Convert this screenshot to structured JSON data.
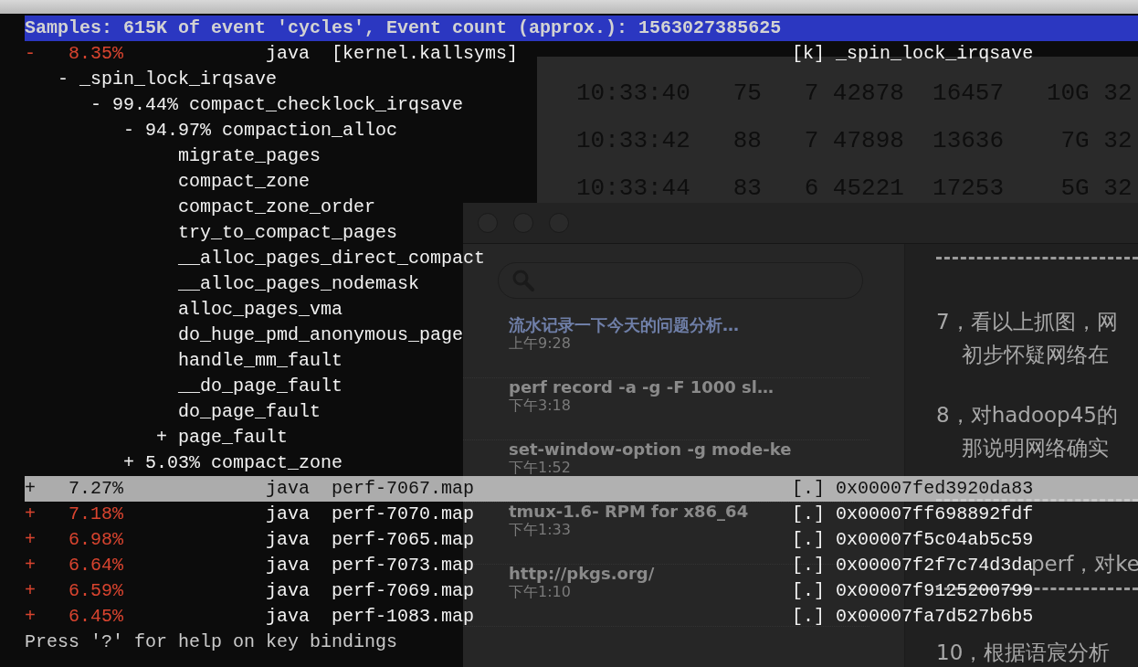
{
  "terminal": {
    "lines": [
      "10:33:40   75   7 42878  16457   10G 32",
      "10:33:42   88   7 47898  13636    7G 32",
      "10:33:44   83   6 45221  17253    5G 32"
    ]
  },
  "notes": {
    "items": [
      {
        "title": "流水记录一下今天的问题分析…",
        "time": "上午9:28",
        "selected": true
      },
      {
        "title": "perf record -a -g -F 1000 sl…",
        "time": "下午3:18",
        "selected": false
      },
      {
        "title": "set-window-option -g mode-ke",
        "time": "下午1:52",
        "selected": false
      },
      {
        "title": "tmux-1.6- RPM for x86_64",
        "time": "下午1:33",
        "selected": false
      },
      {
        "title": "http://pkgs.org/",
        "time": "下午1:10",
        "selected": false
      }
    ],
    "body": [
      {
        "kind": "rule"
      },
      {
        "kind": "text",
        "text": "7，看以上抓图，网"
      },
      {
        "kind": "indent",
        "text": "初步怀疑网络在"
      },
      {
        "kind": "text",
        "text": "8，对hadoop45的"
      },
      {
        "kind": "indent",
        "text": "那说明网络确实"
      },
      {
        "kind": "rule"
      },
      {
        "kind": "offset",
        "text": "perf，对ke"
      },
      {
        "kind": "rule"
      },
      {
        "kind": "text",
        "text": "10，根据语宸分析"
      }
    ]
  },
  "report": {
    "header": "Samples: 615K of event 'cycles', Event count (approx.): 1563027385625",
    "entries": [
      {
        "toggle": "-",
        "percent": "8.35%",
        "command": "java",
        "object": "[kernel.kallsyms]",
        "privilege": "[k]",
        "symbol": "_spin_lock_irqsave",
        "selected": false,
        "callchain": [
          {
            "marker": "-",
            "text": "_spin_lock_irqsave",
            "children": [
              {
                "marker": "-",
                "percent": "99.44%",
                "text": "compact_checklock_irqsave",
                "children": [
                  {
                    "marker": "-",
                    "percent": "94.97%",
                    "text": "compaction_alloc",
                    "children": [
                      {
                        "text": "migrate_pages"
                      },
                      {
                        "text": "compact_zone"
                      },
                      {
                        "text": "compact_zone_order"
                      },
                      {
                        "text": "try_to_compact_pages"
                      },
                      {
                        "text": "__alloc_pages_direct_compact"
                      },
                      {
                        "text": "__alloc_pages_nodemask"
                      },
                      {
                        "text": "alloc_pages_vma"
                      },
                      {
                        "text": "do_huge_pmd_anonymous_page"
                      },
                      {
                        "text": "handle_mm_fault"
                      },
                      {
                        "text": "__do_page_fault"
                      },
                      {
                        "text": "do_page_fault"
                      },
                      {
                        "marker": "+",
                        "text": "page_fault"
                      }
                    ]
                  },
                  {
                    "marker": "+",
                    "percent": "5.03%",
                    "text": "compact_zone"
                  }
                ]
              }
            ]
          }
        ]
      },
      {
        "toggle": "+",
        "percent": "7.27%",
        "command": "java",
        "object": "perf-7067.map",
        "privilege": "[.]",
        "symbol": "0x00007fed3920da83",
        "selected": true
      },
      {
        "toggle": "+",
        "percent": "7.18%",
        "command": "java",
        "object": "perf-7070.map",
        "privilege": "[.]",
        "symbol": "0x00007ff698892fdf",
        "selected": false
      },
      {
        "toggle": "+",
        "percent": "6.98%",
        "command": "java",
        "object": "perf-7065.map",
        "privilege": "[.]",
        "symbol": "0x00007f5c04ab5c59",
        "selected": false
      },
      {
        "toggle": "+",
        "percent": "6.64%",
        "command": "java",
        "object": "perf-7073.map",
        "privilege": "[.]",
        "symbol": "0x00007f2f7c74d3da",
        "selected": false
      },
      {
        "toggle": "+",
        "percent": "6.59%",
        "command": "java",
        "object": "perf-7069.map",
        "privilege": "[.]",
        "symbol": "0x00007f9125200799",
        "selected": false
      },
      {
        "toggle": "+",
        "percent": "6.45%",
        "command": "java",
        "object": "perf-1083.map",
        "privilege": "[.]",
        "symbol": "0x00007fa7d527b6b5",
        "selected": false
      }
    ],
    "hint": "Press '?' for help on key bindings"
  }
}
